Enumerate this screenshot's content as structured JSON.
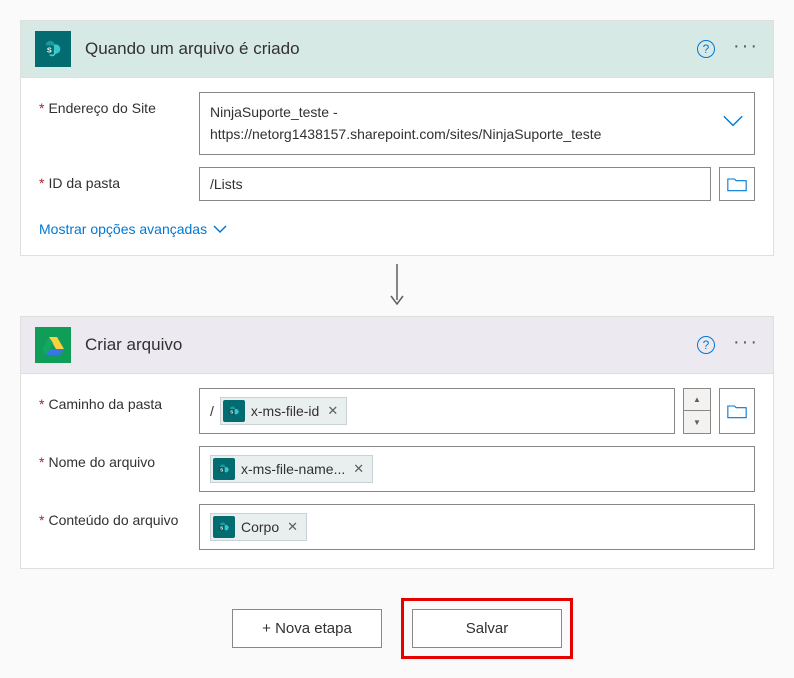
{
  "step1": {
    "title": "Quando um arquivo é criado",
    "fields": {
      "site": {
        "label": "Endereço do Site",
        "line1": "NinjaSuporte_teste -",
        "line2": "https://netorg1438157.sharepoint.com/sites/NinjaSuporte_teste"
      },
      "folder": {
        "label": "ID da pasta",
        "value": "/Lists"
      }
    },
    "advanced": "Mostrar opções avançadas"
  },
  "step2": {
    "title": "Criar arquivo",
    "fields": {
      "path": {
        "label": "Caminho da pasta",
        "prefix": "/"
      },
      "name": {
        "label": "Nome do arquivo"
      },
      "content": {
        "label": "Conteúdo do arquivo"
      }
    },
    "tokens": {
      "fileId": "x-ms-file-id",
      "fileName": "x-ms-file-name...",
      "body": "Corpo"
    }
  },
  "footer": {
    "newStep": "+ Nova etapa",
    "save": "Salvar"
  }
}
